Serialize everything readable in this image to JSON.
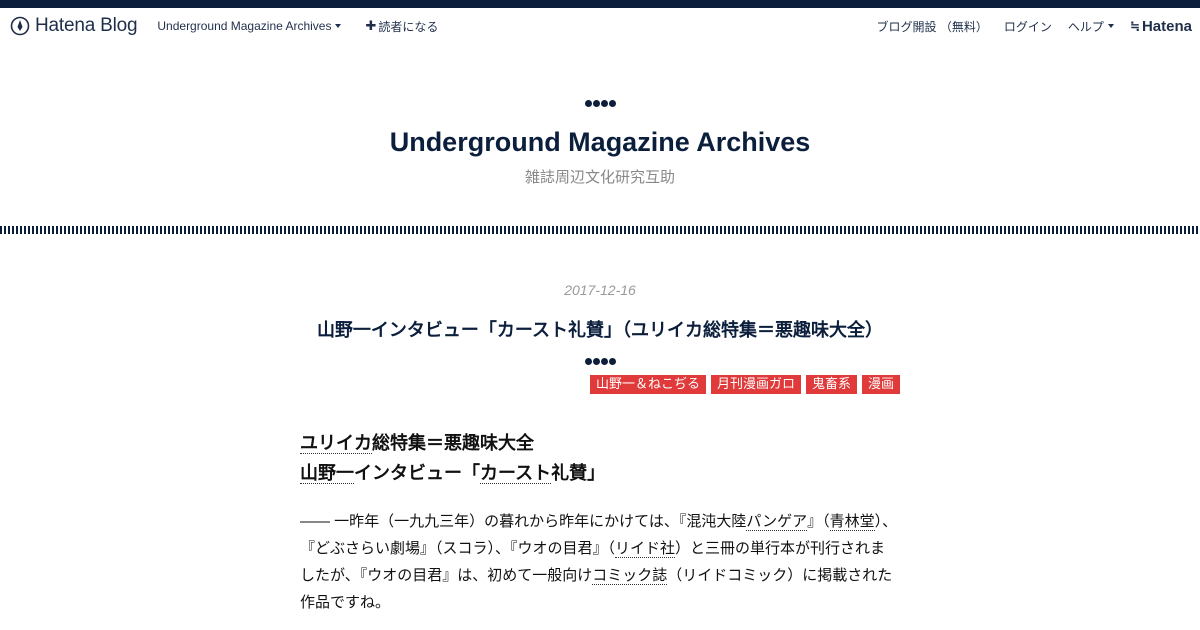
{
  "globalbar": {
    "logo_text": "Hatena Blog",
    "blog_name": "Underground Magazine Archives",
    "subscribe": "読者になる",
    "right_links": [
      "ブログ開設 （無料）",
      "ログイン",
      "ヘルプ"
    ],
    "hatena_logo": "Hatena"
  },
  "blog": {
    "title": "Underground Magazine Archives",
    "description": "雑誌周辺文化研究互助"
  },
  "entry": {
    "date": "2017-12-16",
    "title": "山野一インタビュー「カースト礼賛」（ユリイカ総特集＝悪趣味大全）",
    "categories": [
      "山野一＆ねこぢる",
      "月刊漫画ガロ",
      "鬼畜系",
      "漫画"
    ],
    "heading_line1_kw": "ユリイカ",
    "heading_line1_rest": "総特集＝悪趣味大全",
    "heading_line2_kw": "山野一",
    "heading_line2_mid": "インタビュー「",
    "heading_line2_kw2": "カースト",
    "heading_line2_rest": "礼賛」",
    "paragraph": {
      "t1": "―― 一昨年（一九九三年）の暮れから昨年にかけては、『混沌大陸",
      "k1": "パンゲア",
      "t2": "』（",
      "k2": "青林堂",
      "t3": "）、『どぶさらい劇場』（スコラ）、『ウオの目君』（",
      "k3": "リイド社",
      "t4": "）と三冊の単行本が刊行されましたが、『ウオの目君』は、初めて一般向け",
      "k4": "コミック誌",
      "t5": "（リイドコミック）に掲載された作品ですね。"
    }
  },
  "colors": {
    "navy": "#0b1f3c",
    "category_bg": "#e03a3a",
    "muted": "#888888"
  }
}
